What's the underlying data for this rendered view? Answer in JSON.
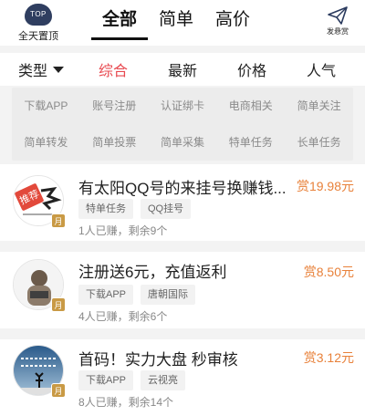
{
  "header": {
    "top_button": {
      "badge": "TOP",
      "label": "全天置顶"
    },
    "tabs": [
      {
        "label": "全部",
        "active": true
      },
      {
        "label": "简单",
        "active": false
      },
      {
        "label": "高价",
        "active": false
      }
    ],
    "publish_label": "发悬赏"
  },
  "sort_bar": {
    "type_label": "类型",
    "items": [
      {
        "label": "综合",
        "active": true
      },
      {
        "label": "最新",
        "active": false
      },
      {
        "label": "价格",
        "active": false
      },
      {
        "label": "人气",
        "active": false
      }
    ]
  },
  "categories": [
    "下载APP",
    "账号注册",
    "认证绑卡",
    "电商相关",
    "简单关注",
    "简单转发",
    "简单投票",
    "简单采集",
    "特单任务",
    "长单任务"
  ],
  "tasks": [
    {
      "title": "有太阳QQ号的来挂号换赚钱...",
      "reward": "赏19.98元",
      "tags": [
        "特单任务",
        "QQ挂号"
      ],
      "meta": "1人已赚，剩余9个",
      "badge": "月",
      "avatar_text": "推荐"
    },
    {
      "title": "注册送6元，充值返利",
      "reward": "赏8.50元",
      "tags": [
        "下载APP",
        "唐朝国际"
      ],
      "meta": "4人已赚，剩余6个",
      "badge": "月",
      "avatar_text": ""
    },
    {
      "title": "首码！实力大盘 秒审核",
      "reward": "赏3.12元",
      "tags": [
        "下载APP",
        "云视亮"
      ],
      "meta": "8人已赚，剩余14个",
      "badge": "月",
      "avatar_text": ""
    }
  ],
  "colors": {
    "accent": "#e8484f",
    "reward": "#e8813a",
    "top_badge": "#2f3e60"
  }
}
